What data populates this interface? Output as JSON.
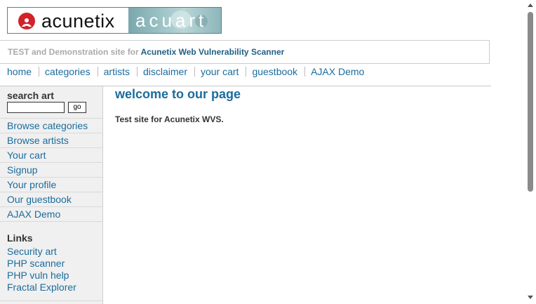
{
  "logo": {
    "brand": "acunetix",
    "product": "acuart"
  },
  "tagline": {
    "prefix": "TEST and Demonstration site for",
    "highlight": "Acunetix Web Vulnerability Scanner"
  },
  "topnav": [
    "home",
    "categories",
    "artists",
    "disclaimer",
    "your cart",
    "guestbook",
    "AJAX Demo"
  ],
  "search": {
    "title": "search art",
    "value": "",
    "button": "go"
  },
  "sidebar_menu": [
    "Browse categories",
    "Browse artists",
    "Your cart",
    "Signup",
    "Your profile",
    "Our guestbook",
    "AJAX Demo"
  ],
  "links": {
    "title": "Links",
    "items": [
      "Security art",
      "PHP scanner",
      "PHP vuln help",
      "Fractal Explorer"
    ]
  },
  "main": {
    "title": "welcome to our page",
    "text": "Test site for Acunetix WVS."
  },
  "colors": {
    "link": "#1b6c9c",
    "tagline_strong": "#1f5f86",
    "sidebar_bg": "#f0f0f0",
    "logo_red": "#d2232a"
  }
}
